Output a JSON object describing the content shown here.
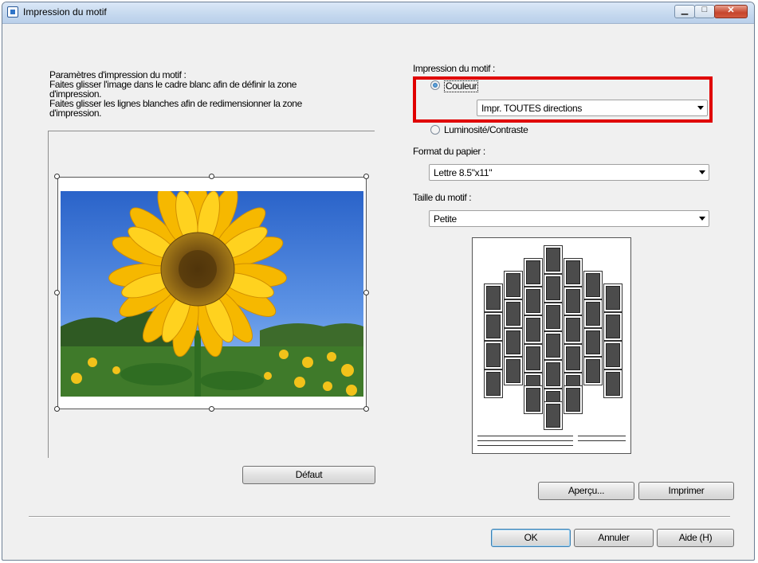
{
  "window": {
    "title": "Impression du motif",
    "minimize_glyph": "▁",
    "maximize_glyph": "□",
    "close_glyph": "✕"
  },
  "left": {
    "instructions": [
      "Paramètres d'impression du motif :",
      "Faites glisser l'image dans le cadre blanc afin de définir la zone",
      "d'impression.",
      "Faites glisser les lignes blanches afin de redimensionner la zone",
      "d'impression."
    ],
    "default_button": "Défaut"
  },
  "right": {
    "pattern_print_label": "Impression du motif :",
    "color_option": "Couleur",
    "color_option_selected": true,
    "direction_select": "Impr. TOUTES directions",
    "brightness_option": "Luminosité/Contraste",
    "paper_size_label": "Format du papier :",
    "paper_size_select": "Lettre 8.5\"x11\"",
    "pattern_size_label": "Taille du motif :",
    "pattern_size_select": "Petite",
    "preview_button": "Aperçu...",
    "print_button": "Imprimer"
  },
  "footer": {
    "ok_button": "OK",
    "cancel_button": "Annuler",
    "help_button": "Aide (H)"
  },
  "colors": {
    "highlight": "#e00000",
    "title_bar": "#c6d9ef",
    "dialog_bg": "#f0f0f0"
  },
  "icons": {
    "title": "app-icon",
    "select_arrow": "chevron-down-icon"
  }
}
